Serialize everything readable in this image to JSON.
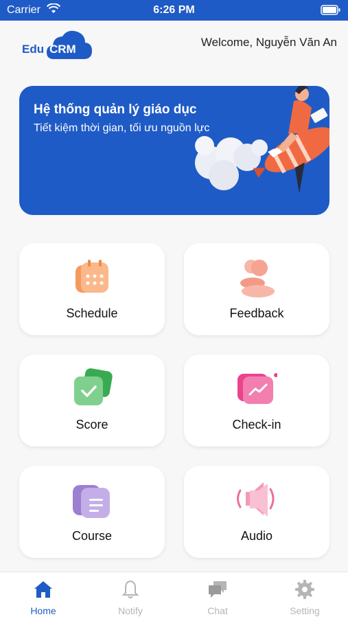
{
  "status_bar": {
    "carrier": "Carrier",
    "time": "6:26 PM"
  },
  "header": {
    "logo_edu": "Edu",
    "logo_crm": "CRM",
    "welcome": "Welcome, Nguyễn Văn An"
  },
  "banner": {
    "title": "Hệ thống quản lý giáo dục",
    "subtitle": "Tiết kiệm thời gian, tối ưu nguồn lực"
  },
  "menu": [
    {
      "label": "Schedule",
      "icon": "calendar-icon"
    },
    {
      "label": "Feedback",
      "icon": "users-icon"
    },
    {
      "label": "Score",
      "icon": "check-card-icon"
    },
    {
      "label": "Check-in",
      "icon": "chart-card-icon"
    },
    {
      "label": "Course",
      "icon": "document-icon"
    },
    {
      "label": "Audio",
      "icon": "speaker-icon"
    }
  ],
  "tabs": [
    {
      "label": "Home",
      "icon": "home-icon",
      "active": true
    },
    {
      "label": "Notify",
      "icon": "bell-icon",
      "active": false
    },
    {
      "label": "Chat",
      "icon": "chat-icon",
      "active": false
    },
    {
      "label": "Setting",
      "icon": "gear-icon",
      "active": false
    }
  ],
  "colors": {
    "primary": "#1f5bc6",
    "inactive": "#b5b5b5",
    "background": "#f7f7f7"
  }
}
